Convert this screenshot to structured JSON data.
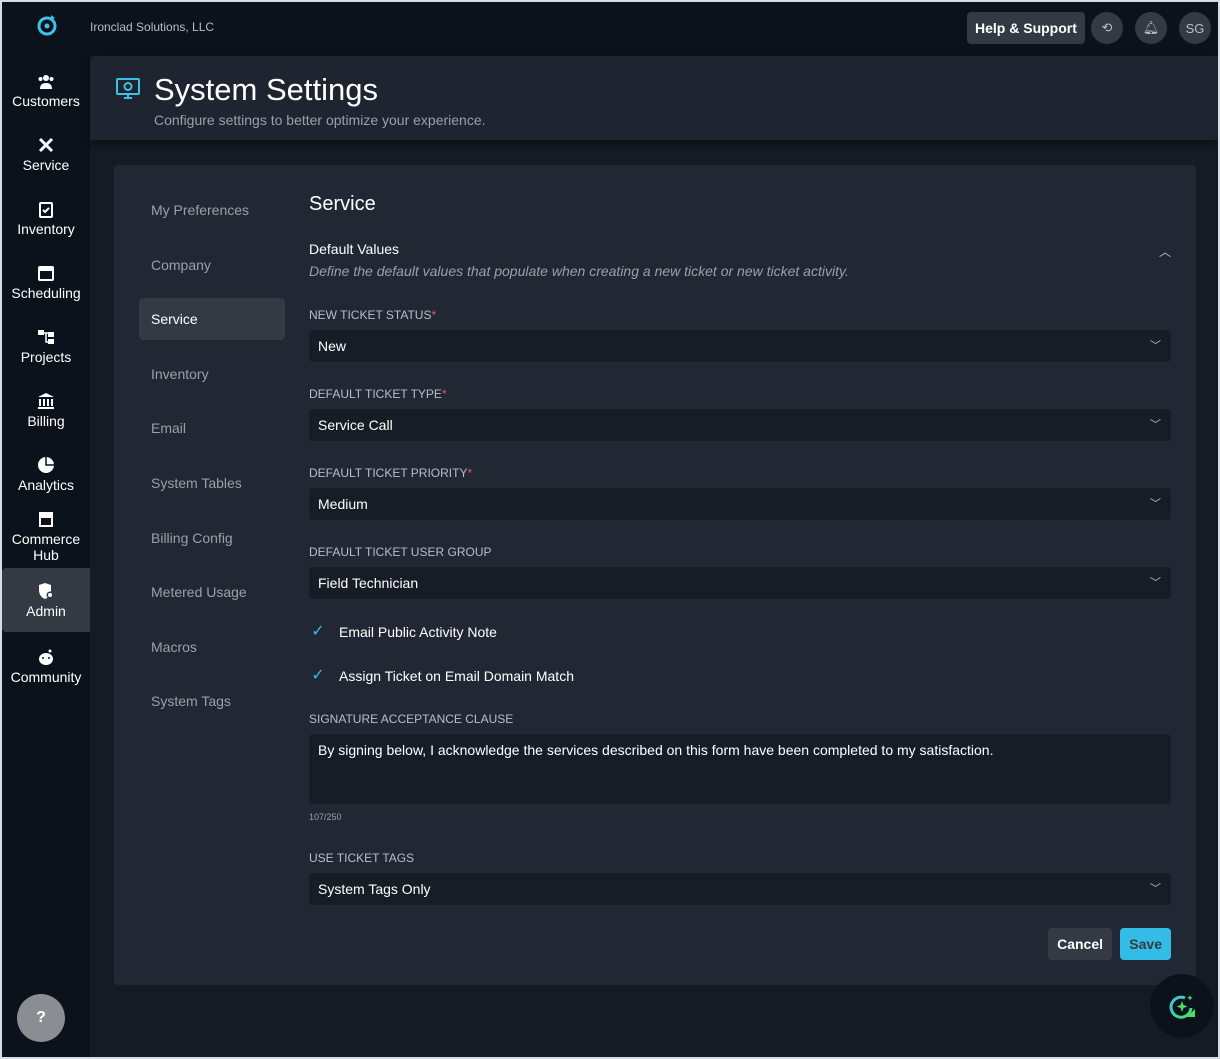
{
  "topbar": {
    "company": "Ironclad Solutions, LLC",
    "help": "Help & Support",
    "avatar": "SG"
  },
  "sidebar": {
    "items": [
      {
        "label": "Customers",
        "icon": "customers-icon"
      },
      {
        "label": "Service",
        "icon": "tools-icon"
      },
      {
        "label": "Inventory",
        "icon": "clipboard-check-icon"
      },
      {
        "label": "Scheduling",
        "icon": "calendar-icon"
      },
      {
        "label": "Projects",
        "icon": "sitemap-icon"
      },
      {
        "label": "Billing",
        "icon": "bank-icon"
      },
      {
        "label": "Analytics",
        "icon": "pie-chart-icon"
      },
      {
        "label": "Commerce Hub",
        "icon": "store-icon"
      },
      {
        "label": "Admin",
        "icon": "shield-user-icon"
      },
      {
        "label": "Community",
        "icon": "community-icon"
      }
    ],
    "help_fab": "?"
  },
  "header": {
    "title": "System Settings",
    "subtitle": "Configure settings to better optimize your experience."
  },
  "settings_nav": [
    "My Preferences",
    "Company",
    "Service",
    "Inventory",
    "Email",
    "System Tables",
    "Billing Config",
    "Metered Usage",
    "Macros",
    "System Tags"
  ],
  "form": {
    "section": "Service",
    "group_title": "Default Values",
    "group_desc": "Define the default values that populate when creating a new ticket or new ticket activity.",
    "status_label": "NEW TICKET STATUS",
    "status": "New",
    "type_label": "DEFAULT TICKET TYPE",
    "type": "Service Call",
    "priority_label": "DEFAULT TICKET PRIORITY",
    "priority": "Medium",
    "group_label": "DEFAULT TICKET USER GROUP",
    "group": "Field Technician",
    "chk1": "Email Public Activity Note",
    "chk2": "Assign Ticket on Email Domain Match",
    "sig_label": "SIGNATURE ACCEPTANCE CLAUSE",
    "sig": "By signing below, I acknowledge the services described on this form have been completed to my satisfaction.",
    "sig_count": "107/250",
    "tags_label": "USE TICKET TAGS",
    "tags": "System Tags Only",
    "cancel": "Cancel",
    "save": "Save",
    "required": "*"
  }
}
